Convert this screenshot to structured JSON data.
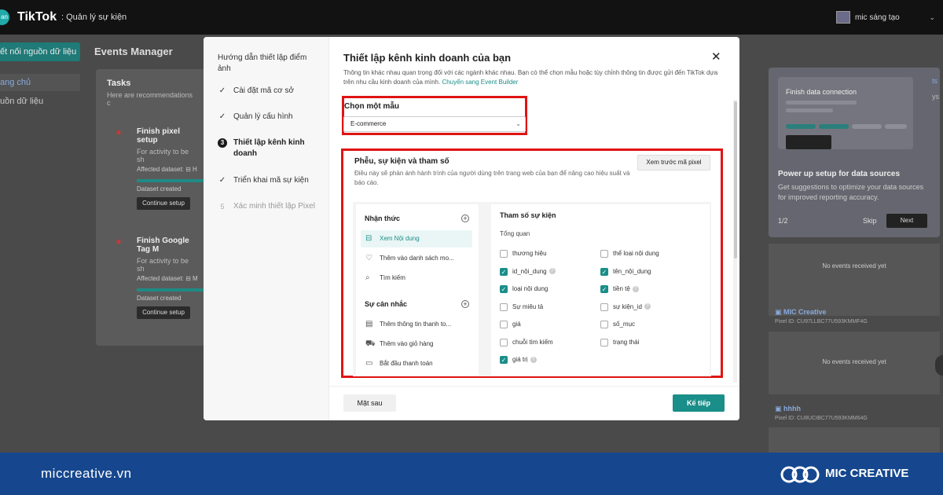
{
  "topbar": {
    "logo_text": "an",
    "brand": "TikTok",
    "brand_sub": ": Quản lý sự kiện",
    "account_name": "mic sáng tạo"
  },
  "background": {
    "sidebar_button": "ết nối nguồn dữ liệu",
    "sidebar_item_home": "ang chủ",
    "sidebar_item_sources": "uồn dữ liệu",
    "page_title": "Events Manager",
    "tasks": {
      "title": "Tasks",
      "subtitle": "Here are recommendations c",
      "items": [
        {
          "title": "Finish pixel setup",
          "desc": "For activity to be sh",
          "dataset_label": "Affected dataset: ",
          "dataset_value": "⊟ H",
          "status": "Dataset created",
          "button": "Continue setup"
        },
        {
          "title": "Finish Google Tag M",
          "desc": "For activity to be sh",
          "dataset_label": "Affected dataset: ",
          "dataset_value": "⊟ M",
          "status": "Dataset created",
          "button": "Continue setup"
        }
      ]
    },
    "right_panel": {
      "card_caption": "Finish data connection",
      "title": "Power up setup for data sources",
      "desc": "Get suggestions to optimize your data sources for improved reporting accuracy.",
      "step": "1/2",
      "skip": "Skip",
      "next": "Next",
      "cut_text_1": "ts",
      "cut_text_2": "ys"
    },
    "datasets": [
      {
        "no_events": "No events received yet"
      },
      {
        "name": "MIC Creative",
        "pixel_id": "Pixel ID: CU97LLBC77U593KMMF4G",
        "no_events": "No events received yet"
      },
      {
        "name": "hhhh",
        "pixel_id": "Pixel ID: CU8UCIBC77U593KMM64G"
      }
    ]
  },
  "modal": {
    "guide_title": "Hướng dẫn thiết lập điểm ảnh",
    "steps": [
      {
        "label": "Cài đặt mã cơ sở",
        "marker": "✓",
        "state": "done"
      },
      {
        "label": "Quản lý cấu hình",
        "marker": "✓",
        "state": "done"
      },
      {
        "label": "Thiết lập kênh kinh doanh",
        "marker": "3",
        "state": "active"
      },
      {
        "label": "Triển khai mã sự kiện",
        "marker": "✓",
        "state": "done"
      },
      {
        "label": "Xác minh thiết lập Pixel",
        "marker": "5",
        "state": "pending"
      }
    ],
    "title": "Thiết lập kênh kinh doanh của bạn",
    "desc": "Thông tin khác nhau quan trọng đối với các ngành khác nhau. Bạn có thể chọn mẫu hoặc tùy chỉnh thông tin được gửi đến TikTok dựa trên nhu cầu kinh doanh của mình.",
    "desc_link": "Chuyển sang Event Builder",
    "template_label": "Chọn một mẫu",
    "template_value": "E-commerce",
    "funnel": {
      "title": "Phễu, sự kiện và tham số",
      "desc": "Điều này sẽ phản ánh hành trình của người dùng trên trang web của bạn để nâng cao hiệu suất và báo cáo.",
      "preview_button": "Xem trước mã pixel",
      "groups": [
        {
          "title": "Nhận thức",
          "events": [
            {
              "label": "Xem Nội dung",
              "icon": "⊟"
            },
            {
              "label": "Thêm vào danh sách mo...",
              "icon": "♡"
            },
            {
              "label": "Tìm kiếm",
              "icon": "⌕"
            }
          ]
        },
        {
          "title": "Sự cân nhắc",
          "events": [
            {
              "label": "Thêm thông tin thanh to...",
              "icon": "▤"
            },
            {
              "label": "Thêm vào giỏ hàng",
              "icon": "⛟"
            },
            {
              "label": "Bắt đầu thanh toán",
              "icon": "▭"
            }
          ]
        }
      ],
      "params_title": "Tham số sự kiện",
      "params_subtitle": "Tổng quan",
      "params": [
        {
          "label": "thương hiệu",
          "checked": false,
          "help": false
        },
        {
          "label": "thể loại nội dung",
          "checked": false,
          "help": false
        },
        {
          "label": "id_nội_dung",
          "checked": true,
          "help": true
        },
        {
          "label": "tên_nội_dung",
          "checked": true,
          "help": false
        },
        {
          "label": "loại nội dung",
          "checked": true,
          "help": false
        },
        {
          "label": "tiền tệ",
          "checked": true,
          "help": true
        },
        {
          "label": "Sự miêu tả",
          "checked": false,
          "help": false
        },
        {
          "label": "sự kiện_id",
          "checked": false,
          "help": true
        },
        {
          "label": "giá",
          "checked": false,
          "help": false
        },
        {
          "label": "số_mục",
          "checked": false,
          "help": false
        },
        {
          "label": "chuỗi tìm kiếm",
          "checked": false,
          "help": false
        },
        {
          "label": "trạng thái",
          "checked": false,
          "help": false
        },
        {
          "label": "giá trị",
          "checked": true,
          "help": true
        }
      ]
    },
    "back_button": "Mặt sau",
    "next_button": "Kế tiếp"
  },
  "brandbar": {
    "url": "miccreative.vn",
    "name": "MIC CREATIVE"
  },
  "colors": {
    "accent": "#1a8e88",
    "highlight_box": "#e01414",
    "brand_blue": "#16478e"
  }
}
